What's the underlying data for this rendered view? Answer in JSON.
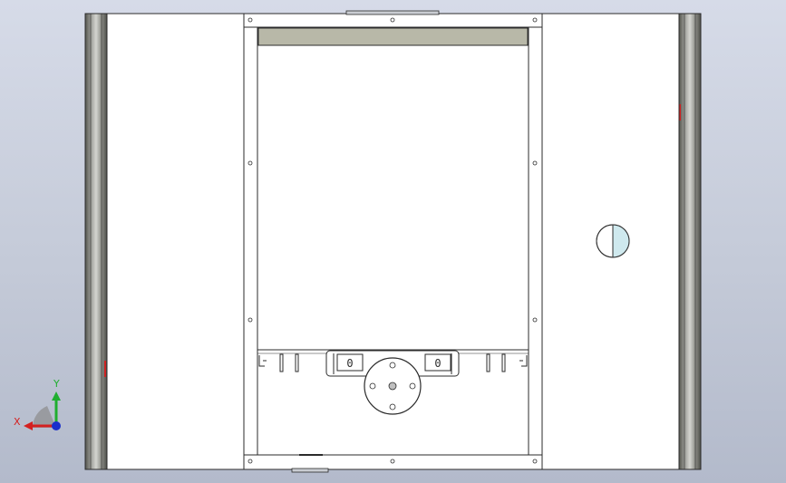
{
  "viewport": {
    "view": "front",
    "background": {
      "top": "#d6dbe8",
      "bottom": "#b3bacb"
    }
  },
  "model": {
    "line_color": "#2b2b2b",
    "panel_fill": "#ffffff",
    "top_strip_fill": "#b8b8a8",
    "rail_dark": "#6e6f6c",
    "rail_light": "#c8c9c4",
    "edge_marks_color": "#cc2222",
    "knob_accent": "#cfe9ee",
    "clamp_labels": [
      "0",
      "0"
    ]
  },
  "triad": {
    "x_label": "X",
    "y_label": "Y",
    "x_color": "#d42020",
    "y_color": "#1fae2f",
    "z_color": "#1a2fcc"
  }
}
